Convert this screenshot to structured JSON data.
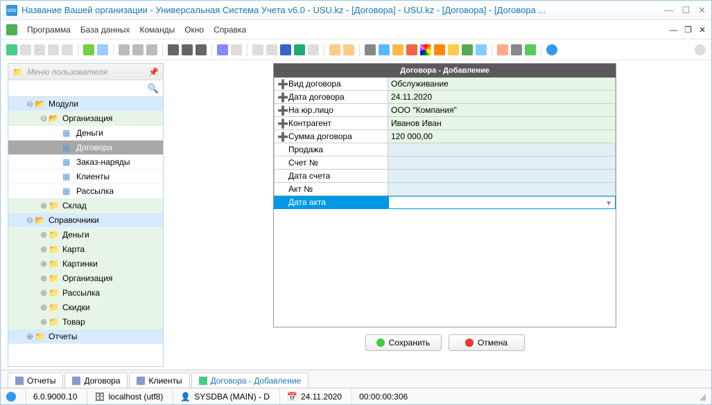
{
  "window": {
    "title": "Название Вашей организации - Универсальная Система Учета v6.0 - USU.kz - [Договора] - USU.kz - [Договора] - [Договора ...",
    "app_icon_text": "usu"
  },
  "menu": {
    "items": [
      "Программа",
      "База данных",
      "Команды",
      "Окно",
      "Справка"
    ]
  },
  "sidebar": {
    "user_menu_label": "Меню пользователя",
    "tree": [
      {
        "label": "Модули",
        "type": "folder-open",
        "level": 1,
        "exp": "⊖",
        "cls": "grp"
      },
      {
        "label": "Организация",
        "type": "folder-open",
        "level": 2,
        "exp": "⊖",
        "cls": "grp2"
      },
      {
        "label": "Деньги",
        "type": "item",
        "level": 3
      },
      {
        "label": "Договора",
        "type": "item",
        "level": 3,
        "selected": true
      },
      {
        "label": "Заказ-наряды",
        "type": "item",
        "level": 3
      },
      {
        "label": "Клиенты",
        "type": "item",
        "level": 3
      },
      {
        "label": "Рассылка",
        "type": "item",
        "level": 3
      },
      {
        "label": "Склад",
        "type": "folder",
        "level": 2,
        "exp": "⊕",
        "cls": "grp2"
      },
      {
        "label": "Справочники",
        "type": "folder-open",
        "level": 1,
        "exp": "⊖",
        "cls": "grp"
      },
      {
        "label": "Деньги",
        "type": "folder",
        "level": 2,
        "exp": "⊕",
        "cls": "grp2"
      },
      {
        "label": "Карта",
        "type": "folder",
        "level": 2,
        "exp": "⊕",
        "cls": "grp2"
      },
      {
        "label": "Картинки",
        "type": "folder",
        "level": 2,
        "exp": "⊕",
        "cls": "grp2"
      },
      {
        "label": "Организация",
        "type": "folder",
        "level": 2,
        "exp": "⊕",
        "cls": "grp2"
      },
      {
        "label": "Рассылка",
        "type": "folder",
        "level": 2,
        "exp": "⊕",
        "cls": "grp2"
      },
      {
        "label": "Скидки",
        "type": "folder",
        "level": 2,
        "exp": "⊕",
        "cls": "grp2"
      },
      {
        "label": "Товар",
        "type": "folder",
        "level": 2,
        "exp": "⊕",
        "cls": "grp2"
      },
      {
        "label": "Отчеты",
        "type": "folder",
        "level": 1,
        "exp": "⊕",
        "cls": "grp"
      }
    ]
  },
  "form": {
    "title": "Договора - Добавление",
    "rows": [
      {
        "label": "Вид договора",
        "value": "Обслуживание",
        "required": true,
        "state": "filled"
      },
      {
        "label": "Дата договора",
        "value": "24.11.2020",
        "required": true,
        "state": "filled"
      },
      {
        "label": "На юр.лицо",
        "value": "ООО \"Компания\"",
        "required": true,
        "state": "filled"
      },
      {
        "label": "Контрагент",
        "value": "Иванов Иван",
        "required": true,
        "state": "filled"
      },
      {
        "label": "Сумма договора",
        "value": "120 000,00",
        "required": true,
        "state": "filled"
      },
      {
        "label": "Продажа",
        "value": "",
        "required": false,
        "state": "empty"
      },
      {
        "label": "Счет №",
        "value": "",
        "required": false,
        "state": "empty"
      },
      {
        "label": "Дата счета",
        "value": "",
        "required": false,
        "state": "empty"
      },
      {
        "label": "Акт №",
        "value": "",
        "required": false,
        "state": "empty"
      },
      {
        "label": "Дата акта",
        "value": "",
        "required": false,
        "state": "active"
      }
    ],
    "save_label": "Сохранить",
    "cancel_label": "Отмена"
  },
  "tabs": {
    "items": [
      {
        "label": "Отчеты",
        "active": false
      },
      {
        "label": "Договора",
        "active": false
      },
      {
        "label": "Клиенты",
        "active": false
      },
      {
        "label": "Договора - Добавление",
        "active": true
      }
    ]
  },
  "status": {
    "version": "6.0.9000.10",
    "host": "localhost (utf8)",
    "user": "SYSDBA (MAIN) - D",
    "date": "24.11.2020",
    "time": "00:00:00:306"
  }
}
